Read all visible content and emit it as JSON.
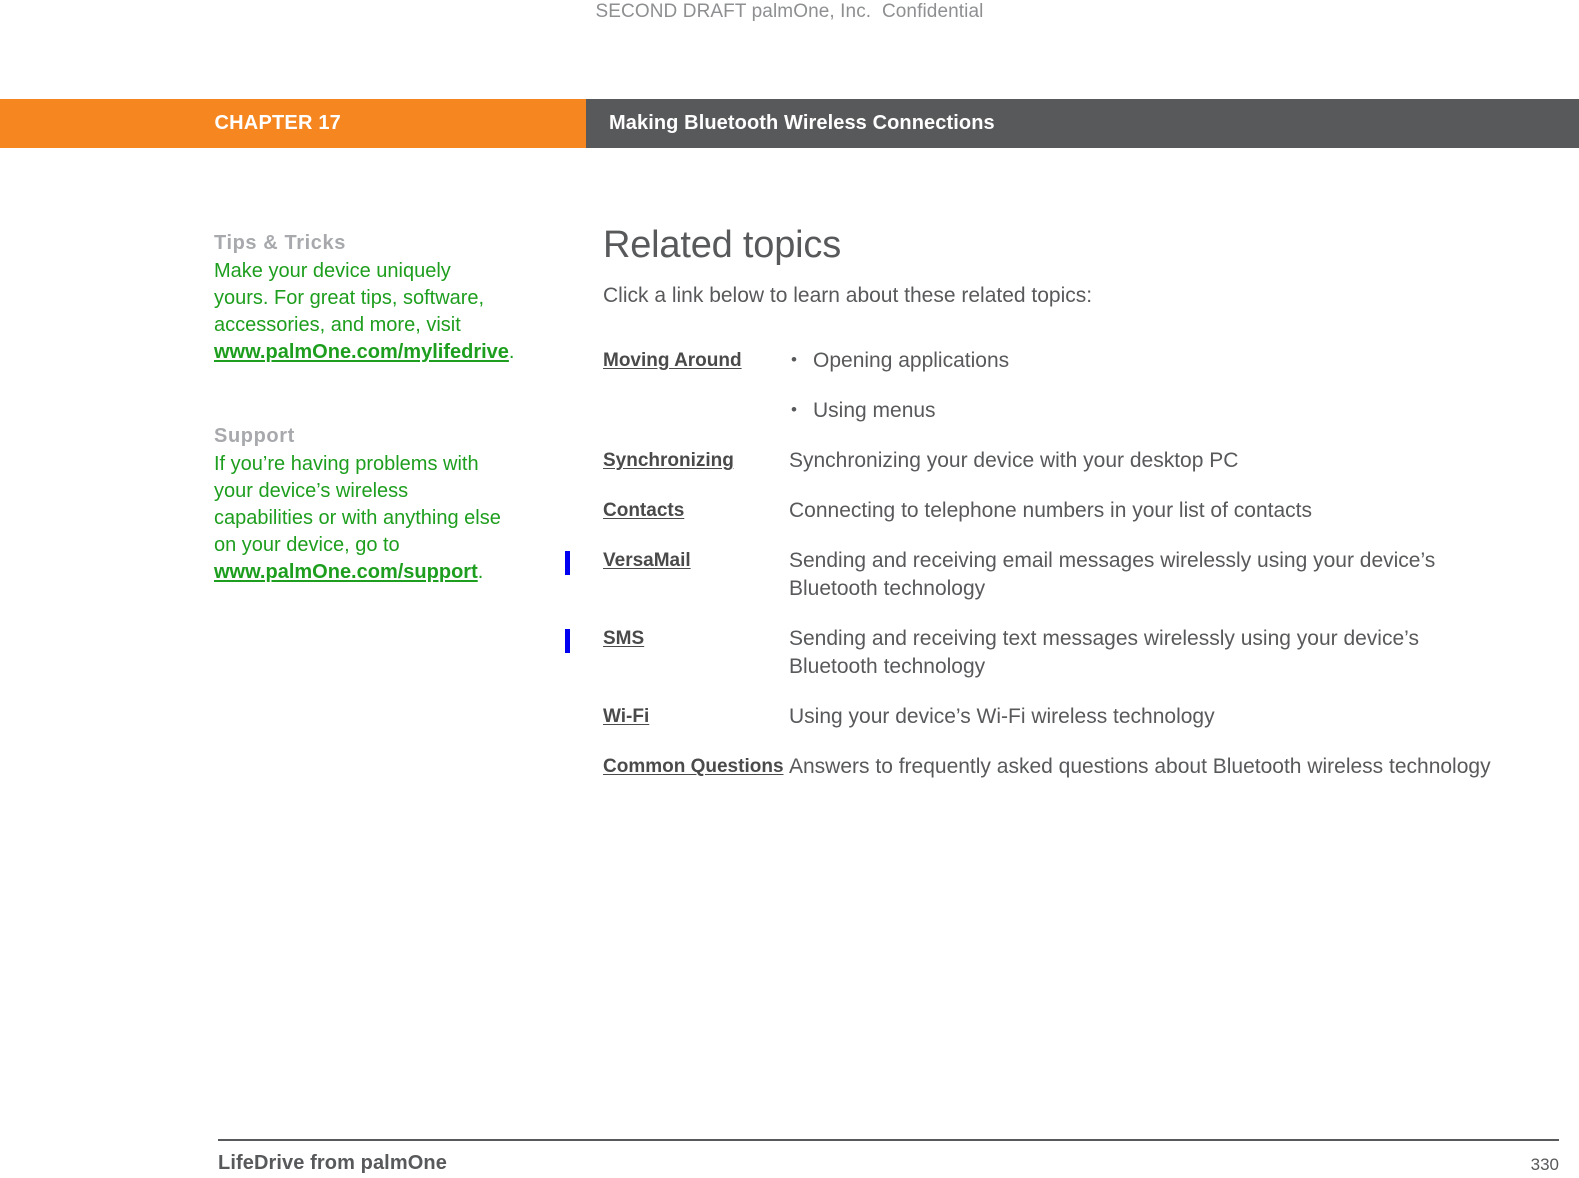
{
  "document": {
    "draft_notice": "SECOND DRAFT palmOne, Inc.  Confidential"
  },
  "header": {
    "chapter_label": "CHAPTER 17",
    "chapter_title": "Making Bluetooth Wireless Connections",
    "orange_color": "#F6861F",
    "gray_color": "#58595B"
  },
  "sidebar": {
    "blocks": [
      {
        "heading": "Tips & Tricks",
        "body_before": "Make your device uniquely yours. For great tips, software, accessories, and more, visit ",
        "link": "www.palmOne.com/mylifedrive",
        "body_after": "."
      },
      {
        "heading": "Support",
        "body_before": "If you’re having problems with your device’s wireless capabilities or with anything else on your device, go to ",
        "link": "www.palmOne.com/support",
        "body_after": "."
      }
    ],
    "link_color": "#1e9e1e",
    "heading_color": "#a7a9ac"
  },
  "main": {
    "title": "Related topics",
    "intro": "Click a link below to learn about these related topics:"
  },
  "topics": {
    "rows": [
      {
        "link": "Moving Around",
        "change_bar": false,
        "bullets": [
          "Opening applications",
          "Using menus"
        ],
        "description": ""
      },
      {
        "link": "Synchronizing",
        "change_bar": false,
        "bullets": [],
        "description": "Synchronizing your device with your desktop PC"
      },
      {
        "link": "Contacts",
        "change_bar": false,
        "bullets": [],
        "description": "Connecting to telephone numbers in your list of contacts"
      },
      {
        "link": "VersaMail",
        "change_bar": true,
        "bullets": [],
        "description": "Sending and receiving email messages wirelessly using your device’s Bluetooth technology"
      },
      {
        "link": "SMS",
        "change_bar": true,
        "bullets": [],
        "description": "Sending and receiving text messages wirelessly using your device’s Bluetooth technology"
      },
      {
        "link": "Wi-Fi",
        "change_bar": false,
        "bullets": [],
        "description": "Using your device’s Wi-Fi wireless technology"
      },
      {
        "link": "Common Questions",
        "change_bar": false,
        "bullets": [],
        "description": "Answers to frequently asked questions about Bluetooth wireless technology"
      }
    ],
    "change_bar_color": "#0000F0"
  },
  "footer": {
    "product": "LifeDrive from palmOne",
    "page_number": "330"
  }
}
